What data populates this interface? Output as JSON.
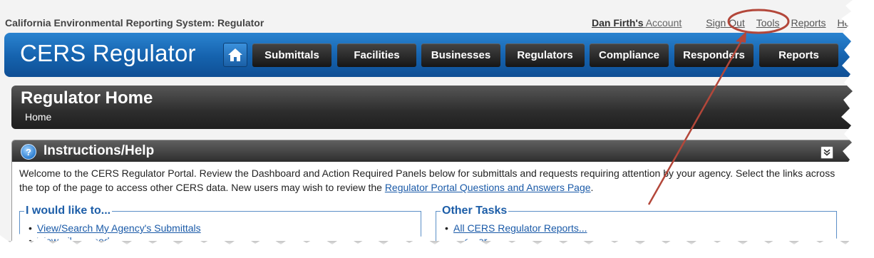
{
  "system_title": "California Environmental Reporting System: Regulator",
  "account": {
    "name": "Dan Firth's",
    "word": "Account"
  },
  "top_links": [
    "Sign Out",
    "Tools",
    "Reports",
    "Help"
  ],
  "brand": "CERS Regulator",
  "nav": [
    "Submittals",
    "Facilities",
    "Businesses",
    "Regulators",
    "Compliance",
    "Responders",
    "Reports"
  ],
  "page": {
    "title": "Regulator Home",
    "breadcrumb": "Home"
  },
  "help_panel": {
    "title": "Instructions/Help",
    "intro_text": "Welcome to the CERS Regulator Portal. Review the Dashboard and Action Required Panels below for submittals and requests requiring attention by your agency. Select the links across the top of the page to access other CERS data. New users may wish to review the ",
    "intro_link": "Regulator Portal Questions and Answers Page",
    "intro_end": "."
  },
  "i_would_like": {
    "legend": "I would like to...",
    "items": [
      "View/Search My Agency's Submittals",
      "View All ... Needs ..."
    ]
  },
  "other_tasks": {
    "legend": "Other Tasks",
    "items": [
      "All CERS Regulator Reports...",
      "... other ..."
    ]
  },
  "colors": {
    "header_blue": "#1562ad",
    "annotation": "#b3473a",
    "link": "#1a5aa8"
  }
}
